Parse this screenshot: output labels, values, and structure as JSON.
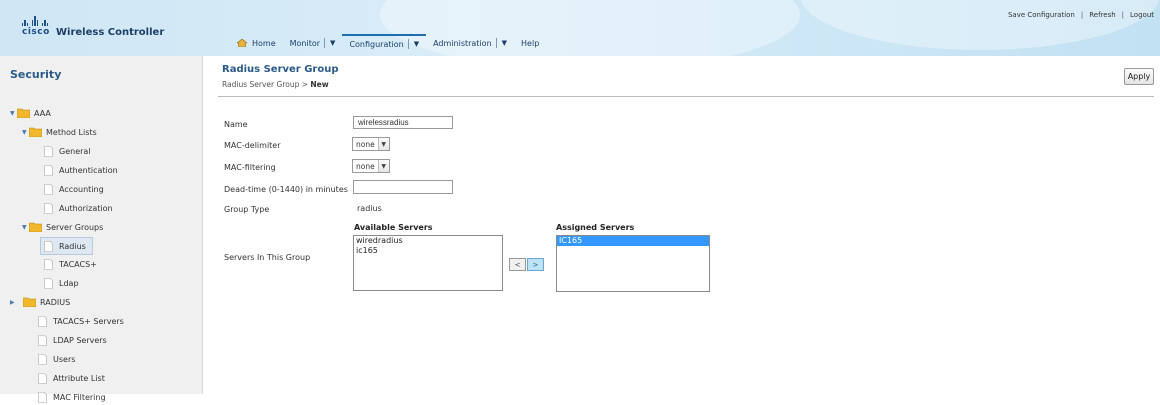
{
  "header": {
    "product_name": "Wireless Controller",
    "brand": "cisco",
    "top_links": [
      "Save Configuration",
      "Refresh",
      "Logout"
    ],
    "nav": [
      {
        "label": "Home",
        "icon": "home-icon",
        "dropdown": false
      },
      {
        "label": "Monitor",
        "dropdown": true
      },
      {
        "label": "Configuration",
        "dropdown": true,
        "active": true
      },
      {
        "label": "Administration",
        "dropdown": true
      },
      {
        "label": "Help",
        "dropdown": false
      }
    ]
  },
  "sidebar": {
    "title": "Security",
    "items": [
      {
        "label": "AAA",
        "type": "folder",
        "expanded": true
      },
      {
        "label": "Method Lists",
        "type": "folder",
        "expanded": true
      },
      {
        "label": "General",
        "type": "page"
      },
      {
        "label": "Authentication",
        "type": "page"
      },
      {
        "label": "Accounting",
        "type": "page"
      },
      {
        "label": "Authorization",
        "type": "page"
      },
      {
        "label": "Server Groups",
        "type": "folder",
        "expanded": true
      },
      {
        "label": "Radius",
        "type": "page",
        "selected": true
      },
      {
        "label": "TACACS+",
        "type": "page"
      },
      {
        "label": "Ldap",
        "type": "page"
      },
      {
        "label": "RADIUS",
        "type": "folder",
        "expanded": false
      },
      {
        "label": "TACACS+ Servers",
        "type": "page"
      },
      {
        "label": "LDAP Servers",
        "type": "page"
      },
      {
        "label": "Users",
        "type": "page"
      },
      {
        "label": "Attribute List",
        "type": "page"
      },
      {
        "label": "MAC Filtering",
        "type": "page"
      }
    ]
  },
  "main": {
    "title": "Radius Server Group",
    "breadcrumb": {
      "parent": "Radius Server Group >",
      "current": "New"
    },
    "apply_label": "Apply",
    "form": {
      "name": {
        "label": "Name",
        "value": "wirelessradius"
      },
      "mac_delimiter": {
        "label": "MAC-delimiter",
        "value": "none"
      },
      "mac_filtering": {
        "label": "MAC-filtering",
        "value": "none"
      },
      "dead_time": {
        "label": "Dead-time (0-1440) in minutes",
        "value": ""
      },
      "group_type": {
        "label": "Group Type",
        "value": "radius"
      },
      "servers": {
        "label": "Servers In This Group",
        "available_label": "Available Servers",
        "available": [
          "wiredradius",
          "ic165"
        ],
        "assigned_label": "Assigned Servers",
        "assigned": [
          "IC165"
        ],
        "remove_button": "<",
        "add_button": ">"
      }
    }
  },
  "colors": {
    "header_bg": "#cfe6f5",
    "link_blue": "#2a5a8a",
    "selection_blue": "#3399ff",
    "sidebar_bg": "#f0f0f0"
  }
}
